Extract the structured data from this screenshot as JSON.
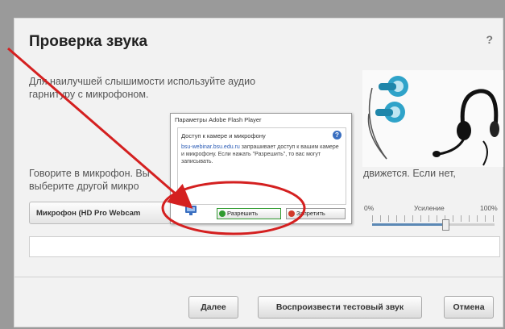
{
  "dialog": {
    "title": "Проверка звука",
    "help": "?",
    "intro_text": "Для наилучшей слышимости используйте аудио гарнитуру с микрофоном.",
    "mic_prompt_left": "Говорите в микрофон. Вы",
    "mic_prompt_left_2": "выберите другой микро",
    "mic_prompt_right": "движется. Если нет,",
    "mic_select_value": "Микрофон (HD Pro Webcam",
    "volume": {
      "min": "0%",
      "label": "Усиление",
      "max": "100%",
      "level": 0.6
    },
    "buttons": {
      "next": "Далее",
      "play_test": "Воспроизвести тестовый звук",
      "cancel": "Отмена"
    }
  },
  "flash": {
    "title": "Параметры Adobe Flash Player",
    "heading": "Доступ к камере и микрофону",
    "link": "bsu-webinar.bsu.edu.ru",
    "msg_after_link": " запрашивает доступ к вашим камере и микрофону. Если нажать \"Разрешить\", то вас могут записывать.",
    "allow": "Разрешить",
    "deny": "Запретить"
  },
  "icons": [
    "help-icon",
    "headset-icon",
    "earbuds-icon",
    "question-icon",
    "camera-icon",
    "allow-check-icon",
    "deny-icon"
  ],
  "colors": {
    "annotation": "#d42020",
    "link": "#2a5bb5",
    "allow": "#2f9a2f",
    "deny": "#d13a2a"
  }
}
